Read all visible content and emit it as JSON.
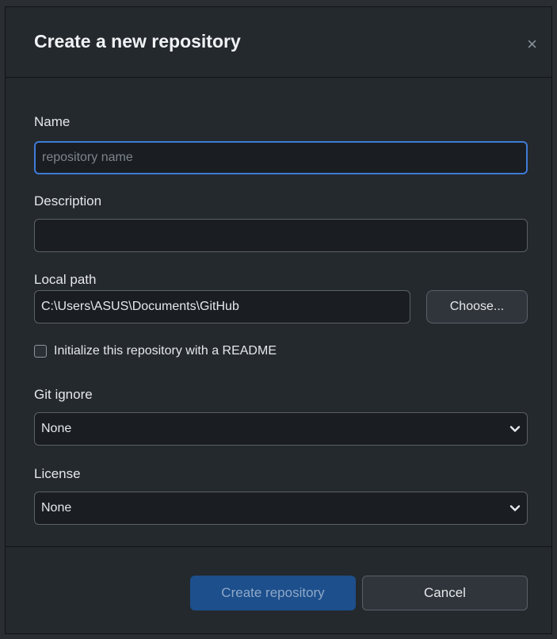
{
  "dialog": {
    "title": "Create a new repository",
    "close_symbol": "×"
  },
  "name": {
    "label": "Name",
    "placeholder": "repository name",
    "value": ""
  },
  "description": {
    "label": "Description",
    "value": ""
  },
  "local_path": {
    "label": "Local path",
    "value": "C:\\Users\\ASUS\\Documents\\GitHub",
    "choose_label": "Choose..."
  },
  "readme": {
    "label": "Initialize this repository with a README",
    "checked": false
  },
  "gitignore": {
    "label": "Git ignore",
    "selected": "None"
  },
  "license": {
    "label": "License",
    "selected": "None"
  },
  "footer": {
    "create_label": "Create repository",
    "cancel_label": "Cancel"
  },
  "colors": {
    "background": "#24292e",
    "primary_button": "#1c4f8c",
    "focus_border": "#3f7bd6"
  },
  "icons": {
    "close": "close-icon",
    "dropdown": "chevron-down-icon",
    "checkbox": "checkbox-unchecked-icon"
  }
}
